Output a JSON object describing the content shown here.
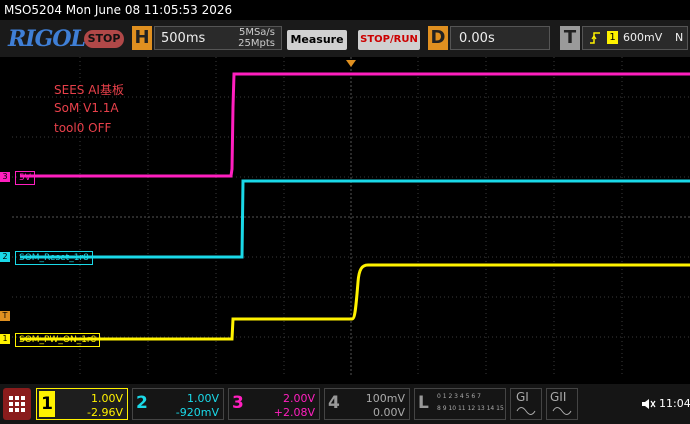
{
  "titlebar": {
    "text": "MSO5204   Mon June 08 11:05:53 2026"
  },
  "topbar": {
    "logo": "RIGOL",
    "run_state": "STOP",
    "horizontal": {
      "key": "H",
      "timebase": "500ms",
      "sample_rate": "5MSa/s",
      "memory_depth": "25Mpts"
    },
    "measure_label": "Measure",
    "stoprun_label": "STOP/RUN",
    "delay": {
      "key": "D",
      "value": "0.00s"
    },
    "trigger": {
      "key": "T",
      "source": "1",
      "level": "600mV",
      "mode": "N"
    }
  },
  "annotations": [
    "SEES AI基板",
    "SoM V1.1A",
    "tool0 OFF"
  ],
  "channels": {
    "ch3": {
      "label": "5V",
      "color": "#ff1fbf"
    },
    "ch2": {
      "label": "SOM_Reset_1r8",
      "color": "#1ad9e8"
    },
    "ch1": {
      "label": "SOM_PW_ON_1r8",
      "color": "#fff200"
    }
  },
  "markers": {
    "ch3": "3",
    "ch2": "2",
    "trig": "T",
    "ch1": "1"
  },
  "bottom": {
    "ch1": {
      "num": "1",
      "scale": "1.00V",
      "offset": "-2.96V"
    },
    "ch2": {
      "num": "2",
      "scale": "1.00V",
      "offset": "-920mV"
    },
    "ch3": {
      "num": "3",
      "scale": "2.00V",
      "offset": "+2.08V"
    },
    "ch4": {
      "num": "4",
      "scale": "100mV",
      "offset": "0.00V"
    },
    "la": {
      "key": "L",
      "row1": "0 1 2 3   4 5 6 7",
      "row2": "8 9 10 11 12 13 14 15"
    },
    "g1": "GI",
    "g2": "GII",
    "time": "11:04"
  }
}
